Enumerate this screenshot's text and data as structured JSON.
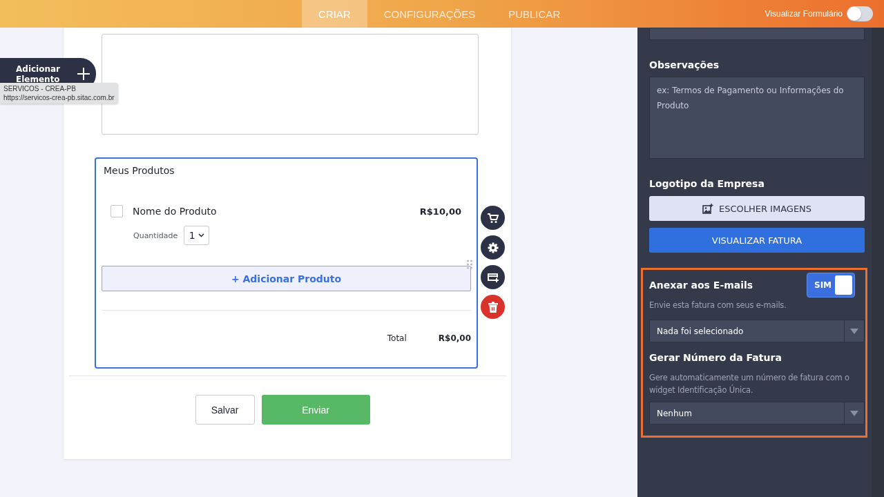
{
  "header": {
    "tabs": [
      {
        "label": "CRIAR",
        "selected": true
      },
      {
        "label": "CONFIGURAÇÕES",
        "selected": false
      },
      {
        "label": "PUBLICAR",
        "selected": false
      }
    ],
    "preview_toggle": {
      "label": "Visualizar Formulário",
      "on": false
    }
  },
  "add_element": {
    "label": "Adicionar Elemento"
  },
  "tooltip": {
    "title": "SERVICOS - CREA-PB",
    "url": "https://servicos-crea-pb.sitac.com.br"
  },
  "form": {
    "products": {
      "title": "Meus Produtos",
      "items": [
        {
          "name": "Nome do Produto",
          "price": "R$10,00",
          "checked": false,
          "quantity_label": "Quantidade",
          "quantity": "1"
        }
      ],
      "add_button": "+ Adicionar Produto",
      "total_label": "Total",
      "total": "R$0,00"
    },
    "buttons": [
      {
        "label": "Salvar",
        "kind": "secondary"
      },
      {
        "label": "Enviar",
        "kind": "primary"
      }
    ]
  },
  "widget_actions": [
    {
      "kind": "cart"
    },
    {
      "kind": "settings"
    },
    {
      "kind": "payment"
    },
    {
      "kind": "delete"
    }
  ],
  "settings": {
    "notes": {
      "label": "Observações",
      "placeholder": "ex: Termos de Pagamento ou Informações do Produto"
    },
    "logo": {
      "label": "Logotipo da Empresa",
      "button": "ESCOLHER IMAGENS"
    },
    "preview_button": "VISUALIZAR FATURA",
    "attach": {
      "label": "Anexar aos E-mails",
      "description": "Envie esta fatura com seus e-mails.",
      "toggle": {
        "label": "SIM",
        "on": true
      },
      "select": "Nada foi selecionado"
    },
    "invoice_number": {
      "label": "Gerar Número da Fatura",
      "description": "Gere automaticamente um número de fatura com o widget Identificação Única.",
      "select": "Nenhum"
    }
  }
}
